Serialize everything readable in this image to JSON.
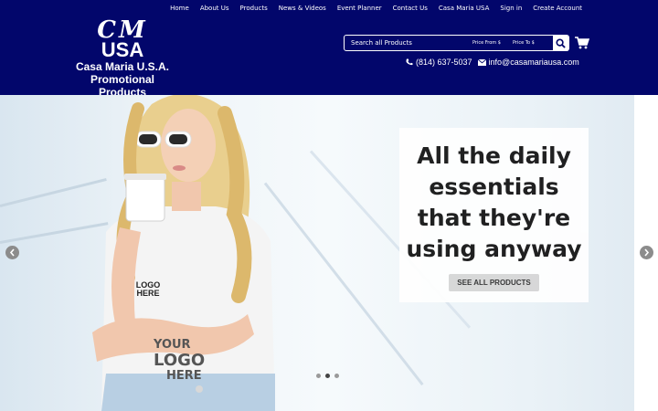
{
  "nav": {
    "links": [
      "Home",
      "About Us",
      "Products",
      "News & Videos",
      "Event Planner",
      "Contact Us",
      "Casa Maria USA",
      "Sign in",
      "Create Account"
    ]
  },
  "logo": {
    "monogram": "CM",
    "usa": "USA",
    "line1": "Casa Maria U.S.A.",
    "line2": "Promotional Products"
  },
  "search": {
    "placeholder": "Search all Products",
    "price_from": "Price From $",
    "price_to": "Price To $"
  },
  "contact": {
    "phone": "(814) 637-5037",
    "email": "info@casamariausa.com"
  },
  "hero": {
    "headline_lines": [
      "All the daily",
      "essentials",
      "that they're",
      "using anyway"
    ],
    "cta_label": "SEE ALL PRODUCTS",
    "shirt_lines": [
      "YOUR",
      "LOGO",
      "HERE"
    ],
    "cup_lines": [
      "LOGO",
      "HERE"
    ],
    "slides_total": 3,
    "active_slide": 2
  },
  "colors": {
    "header_bg": "#02066b",
    "text_light": "#ffffff"
  },
  "icons": {
    "search": "search-icon",
    "cart": "cart-icon",
    "phone": "phone-icon",
    "email": "envelope-icon",
    "prev": "chevron-left-icon",
    "next": "chevron-right-icon"
  }
}
